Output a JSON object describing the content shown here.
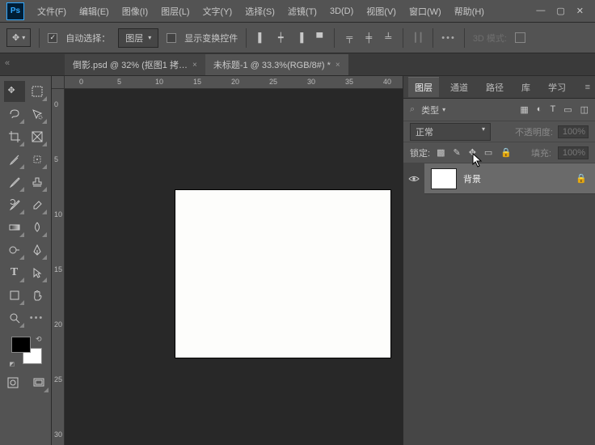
{
  "menu": {
    "items": [
      "文件(F)",
      "编辑(E)",
      "图像(I)",
      "图层(L)",
      "文字(Y)",
      "选择(S)",
      "滤镜(T)",
      "3D(D)",
      "视图(V)",
      "窗口(W)",
      "帮助(H)"
    ]
  },
  "options": {
    "auto_select": "自动选择：",
    "target": "图层",
    "show_transform": "显示变换控件",
    "mode3d": "3D 模式:"
  },
  "tabs": {
    "t1": "倒影.psd @ 32% (抠图1 拷…",
    "t2": "未标题-1 @ 33.3%(RGB/8#) *"
  },
  "rulers": {
    "h": [
      "0",
      "5",
      "10",
      "15",
      "20",
      "25",
      "30",
      "35",
      "40"
    ],
    "v": [
      "0",
      "5",
      "10",
      "15",
      "20",
      "25",
      "30"
    ]
  },
  "panels": {
    "tabs": {
      "layers": "图层",
      "channels": "通道",
      "paths": "路径",
      "library": "库",
      "learn": "学习"
    },
    "filter_type": "类型",
    "blend_mode": "正常",
    "opacity_label": "不透明度:",
    "opacity_value": "100%",
    "lock_label": "锁定:",
    "fill_label": "填充:",
    "fill_value": "100%",
    "layer": {
      "name": "背景"
    }
  }
}
